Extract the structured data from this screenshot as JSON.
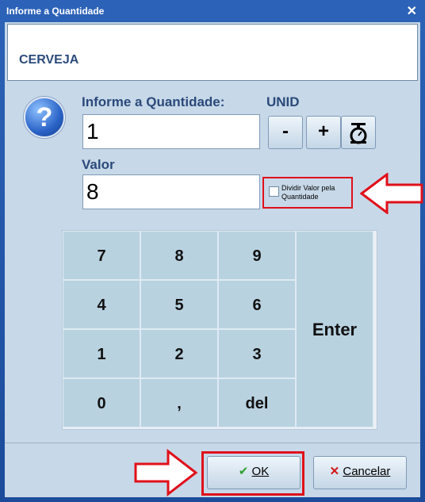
{
  "window": {
    "title": "Informe a Quantidade"
  },
  "product": {
    "name": "CERVEJA"
  },
  "quantity": {
    "label": "Informe a Quantidade:",
    "unit": "UNID",
    "value": "1"
  },
  "buttons": {
    "minus": "-",
    "plus": "+"
  },
  "valor": {
    "label": "Valor",
    "value": "8"
  },
  "checkbox": {
    "label_line1": "Dividir Valor pela",
    "label_line2": "Quantidade",
    "checked": false
  },
  "keypad": {
    "keys": [
      "7",
      "8",
      "9",
      "4",
      "5",
      "6",
      "1",
      "2",
      "3",
      "0",
      ",",
      "del"
    ],
    "enter": "Enter"
  },
  "actions": {
    "ok": "OK",
    "cancel": "Cancelar"
  },
  "colors": {
    "highlight": "#e0101a",
    "label": "#2b4a7a",
    "ok_check": "#2e9e2e",
    "cancel_x": "#d21818"
  }
}
